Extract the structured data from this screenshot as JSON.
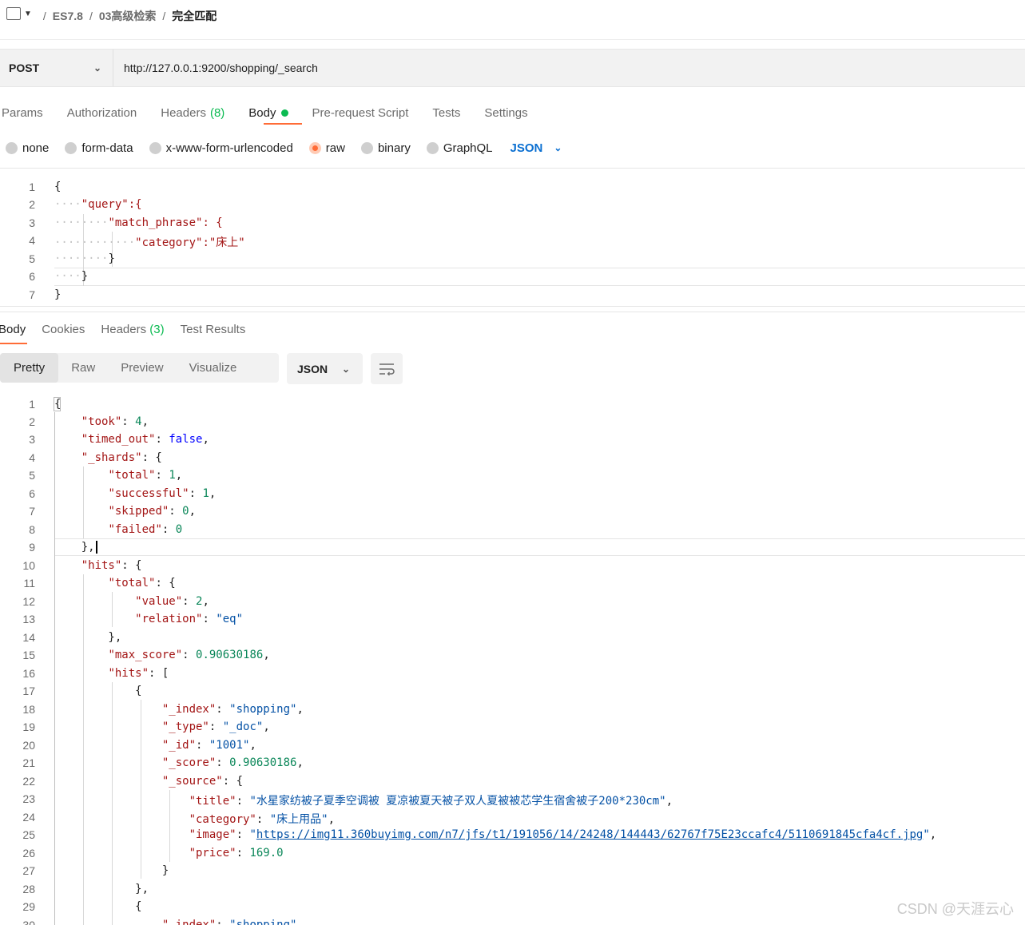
{
  "breadcrumb": {
    "items": [
      "ES7.8",
      "03高级检索"
    ],
    "current": "完全匹配"
  },
  "request": {
    "method": "POST",
    "url": "http://127.0.0.1:9200/shopping/_search"
  },
  "request_tabs": [
    {
      "label": "Params"
    },
    {
      "label": "Authorization"
    },
    {
      "label": "Headers",
      "count": "(8)"
    },
    {
      "label": "Body",
      "active": true
    },
    {
      "label": "Pre-request Script"
    },
    {
      "label": "Tests"
    },
    {
      "label": "Settings"
    }
  ],
  "body_types": [
    "none",
    "form-data",
    "x-www-form-urlencoded",
    "raw",
    "binary",
    "GraphQL"
  ],
  "body_selected": "raw",
  "body_format": "JSON",
  "request_body_lines": [
    "{",
    "\"query\":{",
    "\"match_phrase\": {",
    "\"category\":\"床上\"",
    "}",
    "}",
    "}"
  ],
  "response_tabs": [
    {
      "label": "Body",
      "active": true
    },
    {
      "label": "Cookies"
    },
    {
      "label": "Headers",
      "count": "(3)"
    },
    {
      "label": "Test Results"
    }
  ],
  "view_modes": [
    "Pretty",
    "Raw",
    "Preview",
    "Visualize"
  ],
  "view_active": "Pretty",
  "response_format": "JSON",
  "response_line_numbers": [
    "1",
    "2",
    "3",
    "4",
    "5",
    "6",
    "7",
    "8",
    "9",
    "10",
    "11",
    "12",
    "13",
    "14",
    "15",
    "16",
    "17",
    "18",
    "19",
    "20",
    "21",
    "22",
    "23",
    "24",
    "25",
    "26",
    "27",
    "28",
    "29",
    "30"
  ],
  "response": {
    "took": "4",
    "timed_out": "false",
    "shards_total": "1",
    "shards_successful": "1",
    "shards_skipped": "0",
    "shards_failed": "0",
    "hits_total_value": "2",
    "hits_total_relation": "\"eq\"",
    "max_score": "0.90630186",
    "hit1_index": "\"shopping\"",
    "hit1_type": "\"_doc\"",
    "hit1_id": "\"1001\"",
    "hit1_score": "0.90630186",
    "hit1_title": "\"水星家纺被子夏季空调被 夏凉被夏天被子双人夏被被芯学生宿舍被子200*230cm\"",
    "hit1_category": "\"床上用品\"",
    "hit1_image_url": "https://img11.360buyimg.com/n7/jfs/t1/191056/14/24248/144443/62767f75E23ccafc4/5110691845cfa4cf.jpg",
    "hit1_price": "169.0",
    "hit2_index": "\"shopping\""
  },
  "watermark": "CSDN @天涯云心"
}
